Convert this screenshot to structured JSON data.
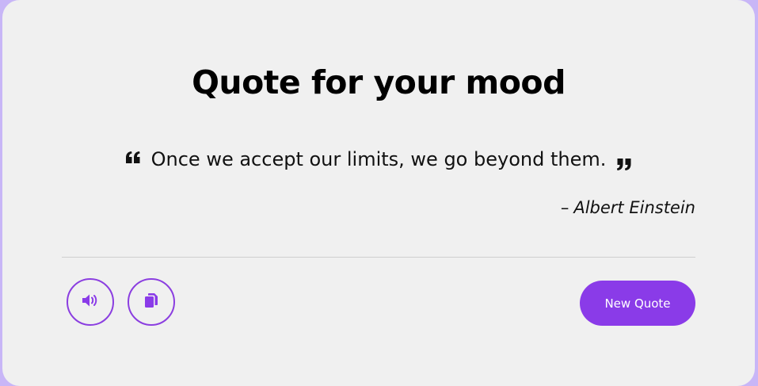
{
  "title": "Quote for your mood",
  "quote": {
    "text": "Once we accept our limits, we go beyond them.",
    "open_icon": "quote-left-icon",
    "close_icon": "quote-right-icon"
  },
  "author": {
    "dash": "–",
    "name": "Albert Einstein"
  },
  "actions": {
    "speak_icon": "volume-icon",
    "copy_icon": "copy-icon",
    "new_quote_label": "New Quote"
  },
  "colors": {
    "accent": "#8a3be8",
    "card_background": "#f0f0f0",
    "page_background": "#c8b6f7",
    "divider": "#cfcfcf"
  }
}
